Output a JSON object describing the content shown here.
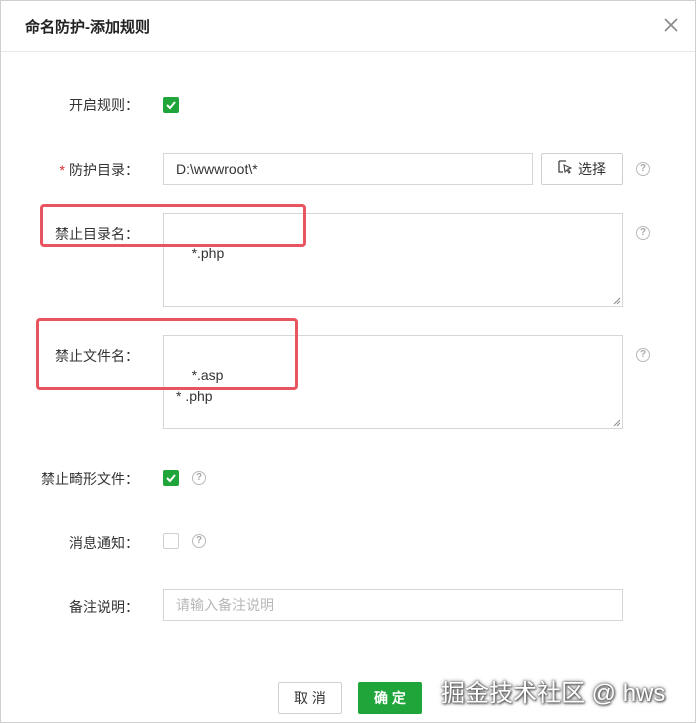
{
  "dialog": {
    "title": "命名防护-添加规则"
  },
  "form": {
    "enable_rule": {
      "label": "开启规则：",
      "checked": true
    },
    "protect_dir": {
      "label": "防护目录：",
      "required_mark": "*",
      "value": "D:\\wwwroot\\*",
      "choose_label": "选择"
    },
    "forbid_dir_name": {
      "label": "禁止目录名：",
      "value": "*.php"
    },
    "forbid_file_name": {
      "label": "禁止文件名：",
      "value": "*.asp\n* .php"
    },
    "forbid_malformed": {
      "label": "禁止畸形文件：",
      "checked": true
    },
    "notify": {
      "label": "消息通知：",
      "checked": false
    },
    "remark": {
      "label": "备注说明：",
      "value": "",
      "placeholder": "请输入备注说明"
    }
  },
  "footer": {
    "cancel_label": "取 消",
    "ok_label": "确 定"
  },
  "help_glyph": "?",
  "watermark": "掘金技术社区 @ hws",
  "colors": {
    "accent": "#20a53a",
    "required": "#e02a2a",
    "highlight_box": "#e8545f"
  },
  "icons": {
    "close": "close-icon",
    "checkmark": "checkmark-icon",
    "choose": "select-cursor-icon",
    "help": "help-circle-icon"
  }
}
